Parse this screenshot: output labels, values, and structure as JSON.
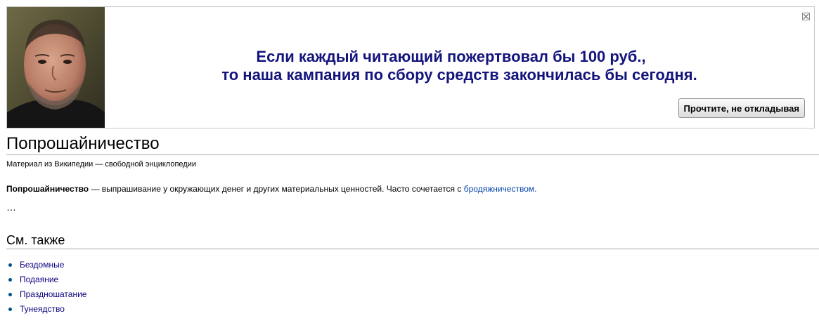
{
  "banner": {
    "appeal_line1": "Если каждый читающий пожертвовал бы 100 руб.,",
    "appeal_line2": "то наша кампания по сбору средств закончилась бы сегодня.",
    "read_button": "Прочтите, не откладывая",
    "close_icon": "close-x-icon",
    "photo": "founder-portrait",
    "appeal_color": "#14147d"
  },
  "article": {
    "title": "Попрошайничество",
    "sitesub": "Материал из Википедии — свободной энциклопедии",
    "intro_term": "Попрошайничество",
    "intro_text": " — выпрашивание у окружающих денег и других материальных ценностей. Часто сочетается с ",
    "intro_link": "бродяжничеством.",
    "ellipsis": "…",
    "see_also_heading": "См. также",
    "see_also": [
      "Бездомные",
      "Подаяние",
      "Праздношатание",
      "Тунеядство"
    ],
    "link_color": "#0645ad"
  }
}
